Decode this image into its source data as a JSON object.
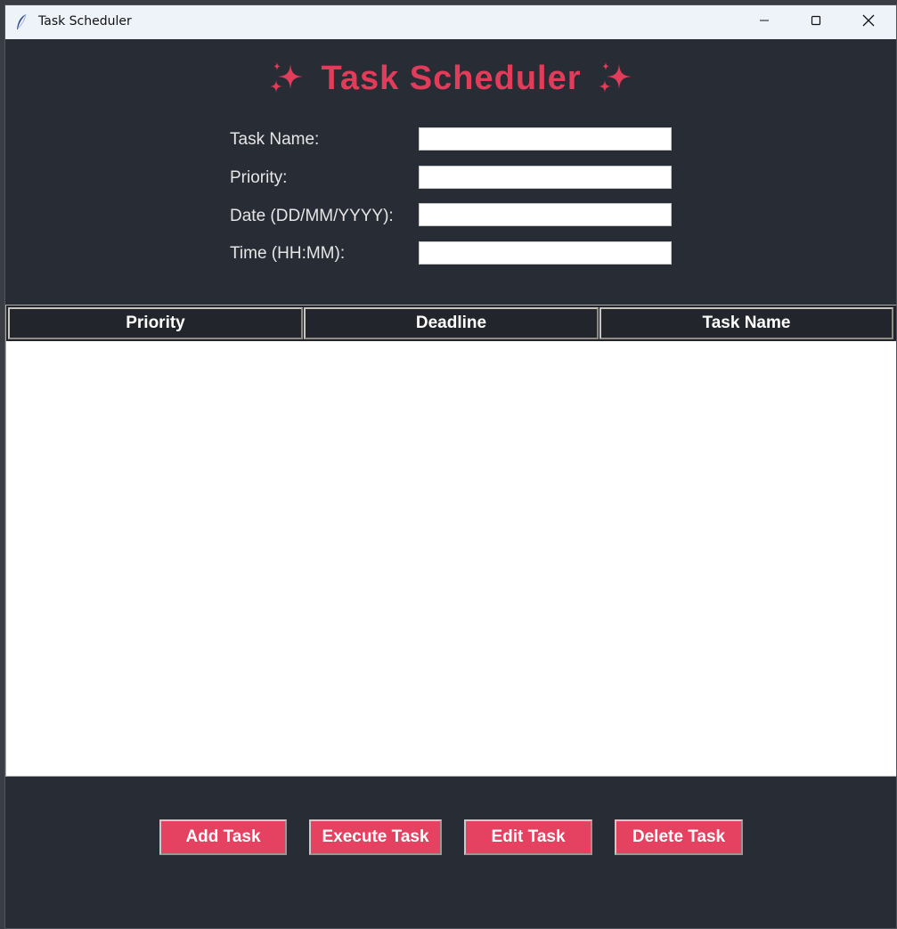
{
  "window": {
    "title": "Task Scheduler",
    "icon": "feather-icon",
    "controls": [
      "minimize-icon",
      "maximize-icon",
      "close-icon"
    ]
  },
  "heading": {
    "text": "Task Scheduler",
    "icon": "sparkles-icon",
    "color": "#e23c5b"
  },
  "form": {
    "task_name_label": "Task Name:",
    "task_name_value": "",
    "priority_label": "Priority:",
    "priority_value": "",
    "date_label": "Date (DD/MM/YYYY):",
    "date_value": "",
    "time_label": "Time (HH:MM):",
    "time_value": ""
  },
  "table": {
    "columns": [
      "Priority",
      "Deadline",
      "Task Name"
    ],
    "rows": []
  },
  "buttons": {
    "add": "Add Task",
    "execute": "Execute Task",
    "edit": "Edit Task",
    "delete": "Delete Task",
    "color": "#e44260"
  },
  "colors": {
    "background": "#282c35",
    "accent": "#e23c5b"
  }
}
